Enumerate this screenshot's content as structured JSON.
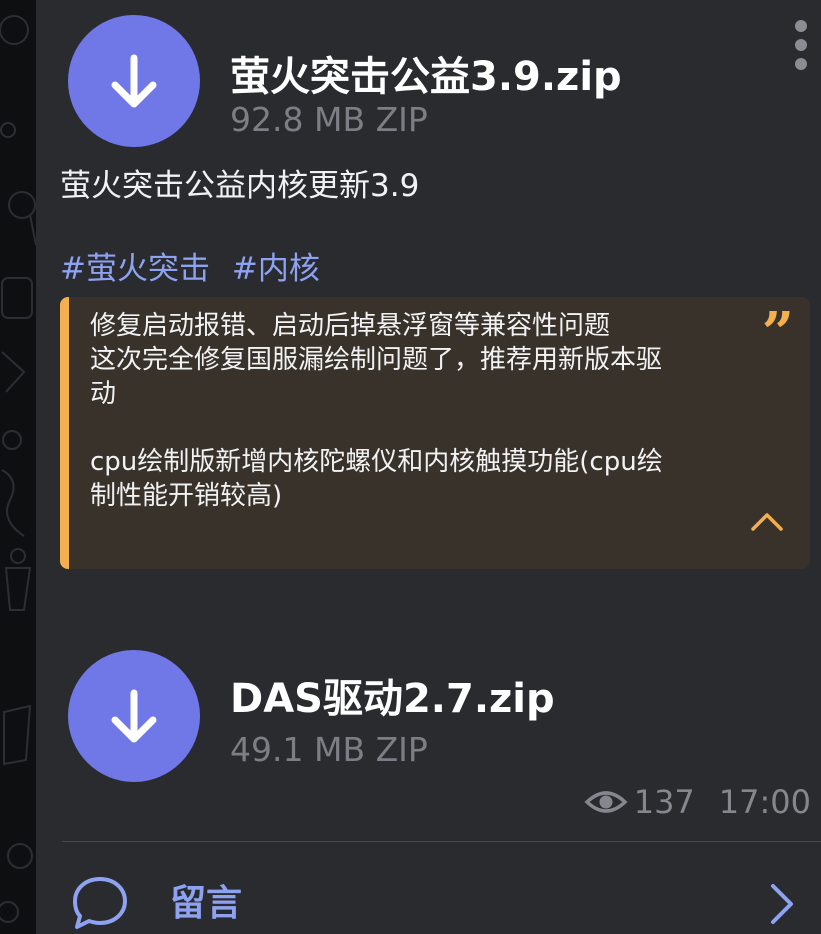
{
  "colors": {
    "background": "#2a2b2f",
    "accent": "#6f78e6",
    "link": "#8ea2f2",
    "quote_accent": "#f4b04e",
    "quote_bg": "#38322b",
    "muted": "#7c7e86"
  },
  "files": [
    {
      "name": "萤火突击公益3.9.zip",
      "size": "92.8 MB ZIP",
      "icon": "download-icon"
    },
    {
      "name": "DAS驱动2.7.zip",
      "size": "49.1 MB ZIP",
      "icon": "download-icon"
    }
  ],
  "caption": "萤火突击公益内核更新3.9",
  "hashtags": [
    "#萤火突击",
    "#内核"
  ],
  "quote": {
    "text": "修复启动报错、启动后掉悬浮窗等兼容性问题\n这次完全修复国服漏绘制问题了，推荐用新版本驱动\n\ncpu绘制版新增内核陀螺仪和内核触摸功能(cpu绘制性能开销较高)",
    "quote_icon": "quote-icon",
    "collapse_icon": "chevron-up-icon"
  },
  "meta": {
    "views": "137",
    "time": "17:00",
    "views_icon": "eye-icon"
  },
  "comment": {
    "label": "留言",
    "icon": "comment-bubble-icon",
    "arrow_icon": "chevron-right-icon"
  },
  "menu_icon": "more-vertical-icon"
}
